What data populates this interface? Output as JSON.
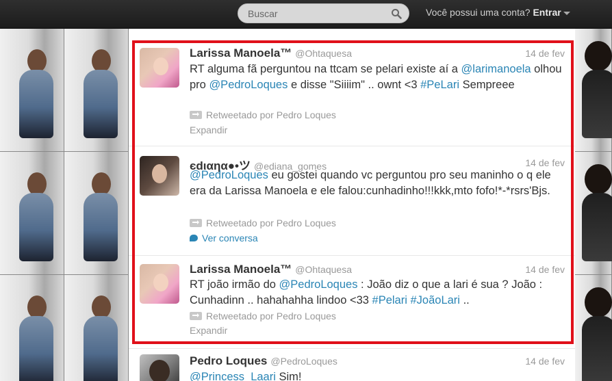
{
  "topbar": {
    "search_placeholder": "Buscar",
    "account_question": "Você possui uma conta?",
    "login_label": "Entrar"
  },
  "tweets": [
    {
      "name": "Larissa Manoela™",
      "handle": "@Ohtaquesa",
      "date": "14 de fev",
      "text_parts": [
        "RT alguma fã perguntou na ttcam se pelari existe aí a ",
        "@larimanoela",
        " olhou pro ",
        "@PedroLoques",
        " e disse \"Siiiim\" .. ownt <3 ",
        "#PeLari",
        " Sempreee"
      ],
      "retweeted_by": "Retweetado por Pedro Loques",
      "action": "Expandir"
    },
    {
      "name": "єdιαηα●•ツ",
      "handle": "@ediana_gomes",
      "date": "14 de fev",
      "text_parts": [
        "@PedroLoques",
        " eu gostei quando vc perguntou pro seu maninho o q ele era da Larissa Manoela e ele falou:cunhadinho!!!kkk,mto fofo!*-*rsrs'Bjs."
      ],
      "retweeted_by": "Retweetado por Pedro Loques",
      "action": "Ver conversa"
    },
    {
      "name": "Larissa Manoela™",
      "handle": "@Ohtaquesa",
      "date": "14 de fev",
      "text_parts": [
        "RT joão irmão do ",
        "@PedroLoques",
        " : João diz o que a lari é sua ? João : Cunhadinn .. hahahahha lindoo <33 ",
        "#Pelari",
        " ",
        "#JoãoLari",
        " .."
      ],
      "retweeted_by": "Retweetado por Pedro Loques",
      "action": "Expandir"
    },
    {
      "name": "Pedro Loques",
      "handle": "@PedroLoques",
      "date": "14 de fev",
      "text_parts": [
        "@Princess_Laari",
        " Sim!"
      ]
    }
  ],
  "colors": {
    "link": "#2a85b5",
    "highlight": "#e0101a",
    "topbar": "#1c1c1c"
  }
}
